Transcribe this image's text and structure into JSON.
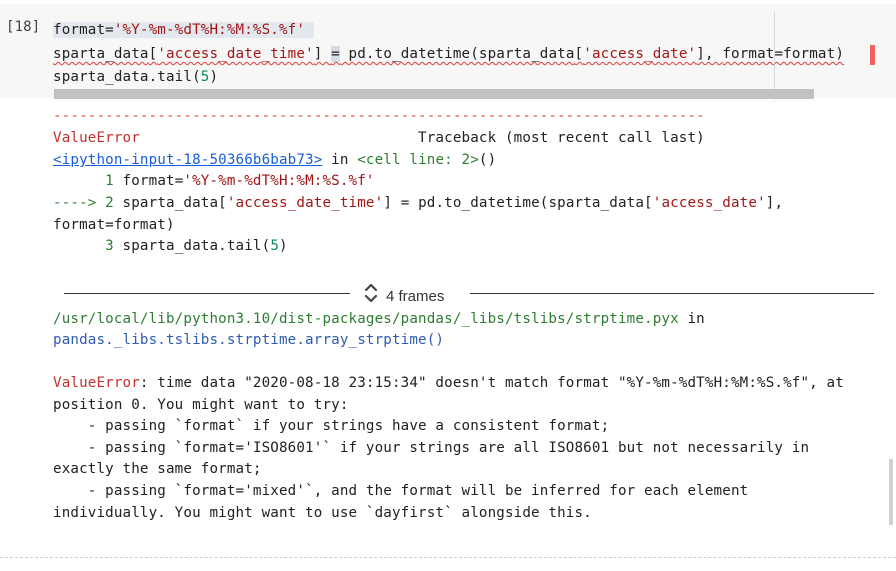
{
  "cell": {
    "execution_count": "[18]",
    "code": {
      "l1_a": "format=",
      "l1_b": "'%Y-%m-%dT%H:%M:%S.%f'",
      "l2_a": "sparta_data",
      "l2_b": "[",
      "l2_c": "'access_date_time'",
      "l2_d": "] ",
      "l2_e": "=",
      "l2_f": " pd.to_datetime(sparta_data",
      "l2_g": "[",
      "l2_h": "'access_date'",
      "l2_i": "], ",
      "l2_j": "format=format)",
      "l3_a": "sparta_data.tail(",
      "l3_b": "5",
      "l3_c": ")"
    }
  },
  "output": {
    "rule": "---------------------------------------------------------------------------",
    "error_name": "ValueError",
    "traceback_header": "                                Traceback (most recent call last)",
    "input_link": "<ipython-input-18-50366b6bab73>",
    "in_word": " in ",
    "cell_line": "<cell line: 2>",
    "cell_line_paren": "()",
    "tb1_num": "      1 ",
    "tb1_a": "format=",
    "tb1_b": "'%Y-%m-%dT%H:%M:%S.%f'",
    "tb2_arrow": "----> 2 ",
    "tb2_a": "sparta_data[",
    "tb2_b": "'access_date_time'",
    "tb2_c": "] = pd.to_datetime(sparta_data[",
    "tb2_d": "'access_date'",
    "tb2_e": "],",
    "tb2_cont": "format=format)",
    "tb3_num": "      3 ",
    "tb3_a": "sparta_data.tail(",
    "tb3_b": "5",
    "tb3_c": ")",
    "frames_label": "4 frames",
    "path": "/usr/local/lib/python3.10/dist-packages/pandas/_libs/tslibs/strptime.pyx",
    "path_in": " in",
    "func": "pandas._libs.tslibs.strptime.array_strptime()",
    "err_name2": "ValueError",
    "msg1": ": time data \"2020-08-18 23:15:34\" doesn't match format \"%Y-%m-%dT%H:%M:%S.%f\", at",
    "msg2": "position 0. You might want to try:",
    "msg3": "    - passing `format` if your strings have a consistent format;",
    "msg4": "    - passing `format='ISO8601'` if your strings are all ISO8601 but not necessarily in",
    "msg5": "exactly the same format;",
    "msg6": "    - passing `format='mixed'`, and the format will be inferred for each element",
    "msg7": "individually. You might want to use `dayfirst` alongside this."
  },
  "colors": {
    "string": "#a31515",
    "number": "#09885a",
    "error": "#c53030",
    "link": "#1a5fd6"
  }
}
